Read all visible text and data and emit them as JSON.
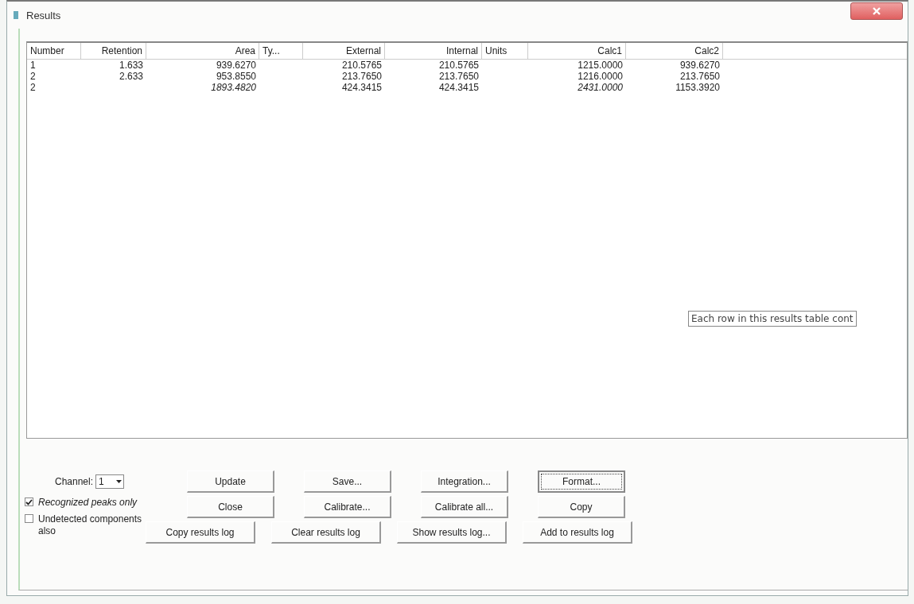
{
  "window": {
    "title": "Results"
  },
  "table": {
    "columns": [
      "Number",
      "Retention",
      "Area",
      "Ty...",
      "External",
      "Internal",
      "Units",
      "Calc1",
      "Calc2"
    ],
    "rows": [
      {
        "cells": [
          {
            "text": "1",
            "italic": false
          },
          {
            "text": "1.633",
            "italic": false
          },
          {
            "text": "939.6270",
            "italic": false
          },
          null,
          {
            "text": "210.5765",
            "italic": false
          },
          {
            "text": "210.5765",
            "italic": false
          },
          null,
          {
            "text": "1215.0000",
            "italic": false
          },
          {
            "text": "939.6270",
            "italic": false
          }
        ]
      },
      {
        "cells": [
          {
            "text": "2",
            "italic": false
          },
          {
            "text": "2.633",
            "italic": false
          },
          {
            "text": "953.8550",
            "italic": false
          },
          null,
          {
            "text": "213.7650",
            "italic": false
          },
          {
            "text": "213.7650",
            "italic": false
          },
          null,
          {
            "text": "1216.0000",
            "italic": false
          },
          {
            "text": "213.7650",
            "italic": false
          }
        ]
      },
      {
        "cells": [
          {
            "text": "2",
            "italic": false
          },
          null,
          {
            "text": "1893.4820",
            "italic": true
          },
          null,
          {
            "text": "424.3415",
            "italic": false
          },
          {
            "text": "424.3415",
            "italic": false
          },
          null,
          {
            "text": "2431.0000",
            "italic": true
          },
          {
            "text": "1153.3920",
            "italic": false
          }
        ]
      }
    ]
  },
  "tooltip": {
    "text": "Each row in this results table cont"
  },
  "channel": {
    "label": "Channel:",
    "value": "1"
  },
  "checkboxes": [
    {
      "label": "Recognized peaks only",
      "checked": true,
      "italic": true
    },
    {
      "label": "Undetected components also",
      "checked": false,
      "italic": false
    }
  ],
  "button_rows": [
    [
      {
        "label": "Update",
        "focused": false
      },
      {
        "label": "Save...",
        "focused": false
      },
      {
        "label": "Integration...",
        "focused": false
      },
      {
        "label": "Format...",
        "focused": true
      }
    ],
    [
      {
        "label": "Close",
        "focused": false
      },
      {
        "label": "Calibrate...",
        "focused": false
      },
      {
        "label": "Calibrate all...",
        "focused": false
      },
      {
        "label": "Copy",
        "focused": false
      }
    ],
    [
      {
        "label": "Copy results log",
        "focused": false
      },
      {
        "label": "Clear results log",
        "focused": false
      },
      {
        "label": "Show results log...",
        "focused": false
      },
      {
        "label": "Add to results log",
        "focused": false
      }
    ]
  ]
}
